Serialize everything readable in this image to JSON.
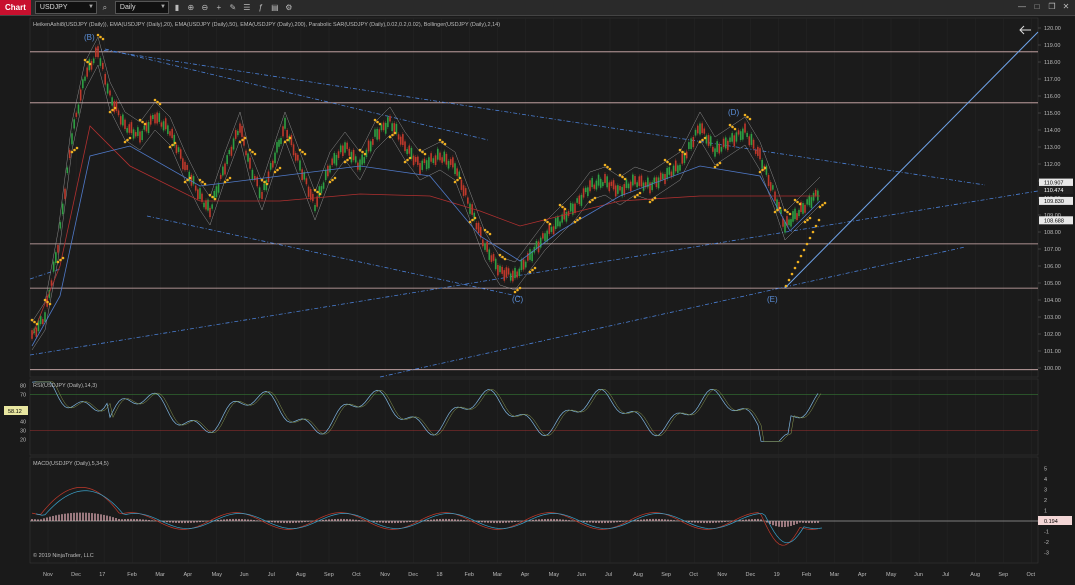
{
  "toolbar": {
    "tab": "Chart",
    "instrument": "USDJPY",
    "interval": "Daily"
  },
  "panels": {
    "price_title": "HeikenAshi8(USDJPY (Daily)), EMA(USDJPY (Daily),20), EMA(USDJPY (Daily),50), EMA(USDJPY (Daily),200), Parabolic SAR(USDJPY (Daily),0.02,0.2,0.02), Bollinger(USDJPY (Daily),2,14)",
    "rsi_title": "RSI(USDJPY (Daily),14,3)",
    "macd_title": "MACD(USDJPY (Daily),5,34,5)",
    "copyright": "© 2019 NinjaTrader, LLC"
  },
  "price_axis": [
    "120.00",
    "119.00",
    "118.00",
    "117.00",
    "116.00",
    "115.00",
    "114.00",
    "113.00",
    "112.00",
    "111.00",
    "110.00",
    "109.00",
    "108.00",
    "107.00",
    "106.00",
    "105.00",
    "104.00",
    "103.00",
    "102.00",
    "101.00",
    "100.00"
  ],
  "price_badges": [
    {
      "label": "110.907",
      "color": "#e8e8e8",
      "text_color": "#000",
      "value": 110.907
    },
    {
      "label": "110.474",
      "color": "#222222",
      "text_color": "#fff",
      "value": 110.474
    },
    {
      "label": "109.830",
      "color": "#e8e8e8",
      "text_color": "#000",
      "value": 109.83
    },
    {
      "label": "108.688",
      "color": "#e8e8e8",
      "text_color": "#000",
      "value": 108.688
    }
  ],
  "rsi_axis": [
    "80",
    "70",
    "50",
    "40",
    "30",
    "20"
  ],
  "rsi_value": "58.12",
  "macd_axis": [
    "5",
    "4",
    "3",
    "2",
    "1",
    "0",
    "-1",
    "-2",
    "-3"
  ],
  "macd_value": "0.194",
  "time_axis": [
    "Nov",
    "Dec",
    "17",
    "Feb",
    "Mar",
    "Apr",
    "May",
    "Jun",
    "Jul",
    "Aug",
    "Sep",
    "Oct",
    "Nov",
    "Dec",
    "18",
    "Feb",
    "Mar",
    "Apr",
    "May",
    "Jun",
    "Jul",
    "Aug",
    "Sep",
    "Oct",
    "Nov",
    "Dec",
    "19",
    "Feb",
    "Mar",
    "Apr",
    "May",
    "Jun",
    "Jul",
    "Aug",
    "Sep",
    "Oct"
  ],
  "wave_labels": [
    "(B)",
    "(C)",
    "(D)",
    "(E)"
  ],
  "horizontal_levels": [
    118.6,
    115.6,
    107.3,
    104.7,
    99.9
  ],
  "colors": {
    "background": "#1a1a1a",
    "level_line": "#d8b4b4",
    "trendline": "#4a7fd4",
    "sar": "#f0b020",
    "up_candle": "#2ea043",
    "down_candle": "#c0392b",
    "rsi_line": "#7fb6e0",
    "macd_line": "#c0392b",
    "macd_signal": "#3aa0c8"
  }
}
